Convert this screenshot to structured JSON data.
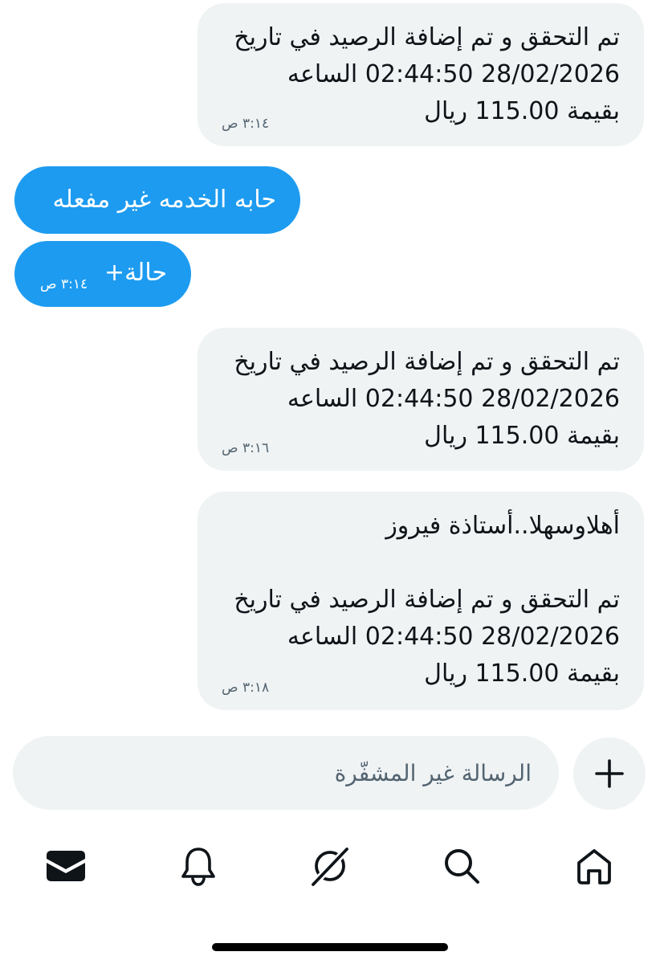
{
  "messages": [
    {
      "direction": "incoming",
      "lines": [
        "تم التحقق و تم إضافة الرصيد في تاريخ",
        "28/02/2026 02:44:50 الساعه",
        "بقيمة 115.00 ريال"
      ],
      "time": "٣:١٤ ص"
    },
    {
      "direction": "outgoing",
      "text": "حابه الخدمه غير مفعله",
      "time": ""
    },
    {
      "direction": "outgoing",
      "text": "حالة+",
      "time": "٣:١٤ ص"
    },
    {
      "direction": "incoming",
      "lines": [
        "تم التحقق و تم إضافة الرصيد في تاريخ",
        "28/02/2026 02:44:50 الساعه",
        "بقيمة 115.00 ريال"
      ],
      "time": "٣:١٦ ص"
    },
    {
      "direction": "incoming",
      "lines": [
        "أهلاوسهلا..أستاذة فيروز",
        "",
        "تم التحقق و تم إضافة الرصيد في تاريخ",
        "28/02/2026 02:44:50 الساعه",
        "بقيمة 115.00 ريال"
      ],
      "time": "٣:١٨ ص"
    }
  ],
  "composer": {
    "placeholder": "الرسالة غير المشفّرة",
    "add_icon": "plus-icon"
  },
  "nav": {
    "items": [
      {
        "name": "messages",
        "icon": "envelope-icon",
        "active": true
      },
      {
        "name": "notifications",
        "icon": "bell-icon",
        "active": false
      },
      {
        "name": "grok",
        "icon": "grok-icon",
        "active": false
      },
      {
        "name": "search",
        "icon": "search-icon",
        "active": false
      },
      {
        "name": "home",
        "icon": "home-icon",
        "active": false
      }
    ]
  },
  "colors": {
    "incoming_bubble": "#eff3f4",
    "outgoing_bubble": "#1d9bf0",
    "text": "#0f1419",
    "secondary_text": "#536471"
  }
}
